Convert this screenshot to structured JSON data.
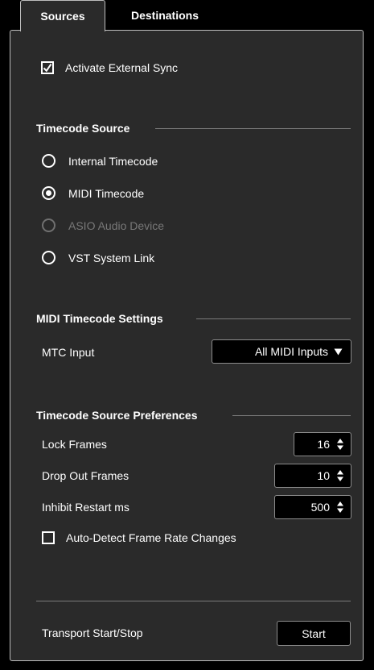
{
  "tabs": {
    "sources": "Sources",
    "destinations": "Destinations"
  },
  "activate_sync": {
    "label": "Activate External Sync",
    "checked": true
  },
  "timecode_source": {
    "heading": "Timecode Source",
    "options": [
      {
        "label": "Internal Timecode",
        "selected": false,
        "enabled": true
      },
      {
        "label": "MIDI Timecode",
        "selected": true,
        "enabled": true
      },
      {
        "label": "ASIO Audio Device",
        "selected": false,
        "enabled": false
      },
      {
        "label": "VST System Link",
        "selected": false,
        "enabled": true
      }
    ]
  },
  "midi_timecode_settings": {
    "heading": "MIDI Timecode Settings",
    "mtc_input_label": "MTC Input",
    "mtc_input_value": "All MIDI Inputs"
  },
  "preferences": {
    "heading": "Timecode Source Preferences",
    "lock_frames": {
      "label": "Lock Frames",
      "value": "16"
    },
    "drop_out_frames": {
      "label": "Drop Out Frames",
      "value": "10"
    },
    "inhibit_restart": {
      "label": "Inhibit Restart ms",
      "value": "500"
    },
    "auto_detect": {
      "label": "Auto-Detect Frame Rate Changes",
      "checked": false
    }
  },
  "transport": {
    "label": "Transport Start/Stop",
    "button": "Start"
  },
  "colors": {
    "background": "#2a2a2a",
    "field_bg": "#000000",
    "text": "#ffffff",
    "disabled_text": "#787878"
  }
}
